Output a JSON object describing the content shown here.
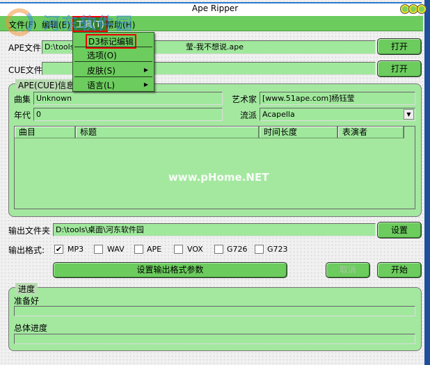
{
  "window": {
    "title": "Ape Ripper"
  },
  "watermark": {
    "logo_text": "河东软件园",
    "site": "www.pHome.NET"
  },
  "menubar": {
    "items": [
      {
        "label": "文件(F)"
      },
      {
        "label": "编辑(E)"
      },
      {
        "label": "工具(T)"
      },
      {
        "label": "帮助(H)"
      }
    ]
  },
  "tools_menu": {
    "items": [
      {
        "label": "D3标记编辑"
      },
      {
        "label": "选项(O)"
      },
      {
        "label": "皮肤(S)",
        "submenu": true
      },
      {
        "label": "语言(L)",
        "submenu": true
      }
    ],
    "submenu_arrow": "▶"
  },
  "ape_file": {
    "label": "APE文件",
    "value": "D:\\tools\\...\\[www.51ape.com]杨钰莹-我不想说.ape",
    "visible_left": "D:\\tools",
    "visible_right": "莹-我不想说.ape",
    "button": "打开"
  },
  "cue_file": {
    "label": "CUE文件",
    "value": "",
    "button": "打开"
  },
  "info_group": {
    "legend": "APE(CUE)信息",
    "album_label": "曲集",
    "album": "Unknown",
    "artist_label": "艺术家",
    "artist": "[www.51ape.com]杨钰莹",
    "year_label": "年代",
    "year": "0",
    "genre_label": "流派",
    "genre": "Acapella",
    "columns": [
      "曲目",
      "标题",
      "时间长度",
      "表演者"
    ],
    "rows": []
  },
  "output": {
    "folder_label": "输出文件夹",
    "folder": "D:\\tools\\桌面\\河东软件园",
    "set_button": "设置",
    "format_label": "输出格式:",
    "formats": [
      {
        "name": "MP3",
        "checked": true
      },
      {
        "name": "WAV",
        "checked": false
      },
      {
        "name": "APE",
        "checked": false
      },
      {
        "name": "VOX",
        "checked": false
      },
      {
        "name": "G726",
        "checked": false
      },
      {
        "name": "G723",
        "checked": false
      }
    ],
    "params_button": "设置输出格式参数",
    "cancel_button": "取消",
    "start_button": "开始"
  },
  "progress": {
    "legend": "进度",
    "status": "准备好",
    "current": 0,
    "total_label": "总体进度",
    "total": 0
  },
  "colors": {
    "accent": "#6ccc5e",
    "field": "#a0e89c",
    "highlight": "#2f7d2a"
  }
}
